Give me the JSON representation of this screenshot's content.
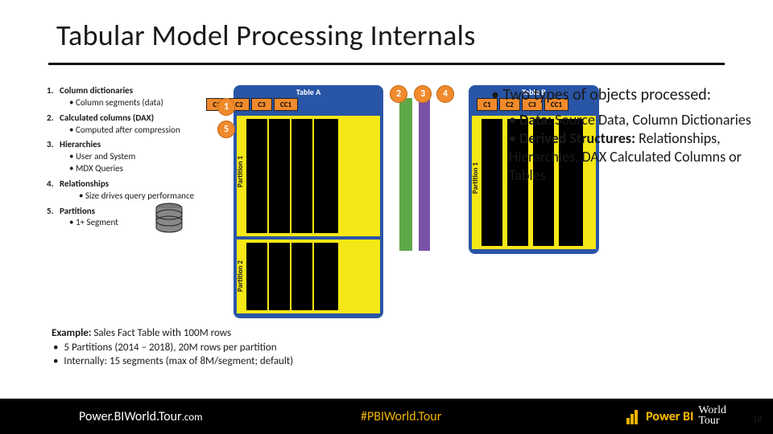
{
  "title": "Tabular Model Processing Internals",
  "leftList": [
    {
      "num": "1.",
      "label": "Column dictionaries",
      "sub": [
        "Column segments (data)"
      ]
    },
    {
      "num": "2.",
      "label": "Calculated columns (DAX)",
      "sub": [
        "Computed after compression"
      ]
    },
    {
      "num": "3.",
      "label": "Hierarchies",
      "sub": [
        "User and System",
        "MDX Queries"
      ]
    },
    {
      "num": "4.",
      "label": "Relationships",
      "sub": [
        "Size drives query performance"
      ]
    },
    {
      "num": "5.",
      "label": "Partitions",
      "sub": [
        "1+ Segment"
      ]
    }
  ],
  "diagram": {
    "tableA": {
      "title": "Table A",
      "cols": [
        "C1",
        "C2",
        "C3",
        "CC1"
      ],
      "part1": "Partition 1",
      "part2": "Partition 2"
    },
    "tableB": {
      "title": "Table B",
      "cols": [
        "C1",
        "C2",
        "C3",
        "CC1"
      ],
      "part1": "Partition 1"
    },
    "callouts": {
      "c1": "1",
      "c2": "2",
      "c3": "3",
      "c4": "4",
      "c5": "5"
    }
  },
  "right": {
    "line1": "Two types of objects processed:",
    "sub": [
      {
        "lead": "Data:",
        "rest": " Source Data, Column Dictionaries"
      },
      {
        "lead": "Derived Structures:",
        "rest": " Relationships, Hierarchies, DAX Calculated Columns or Tables"
      }
    ]
  },
  "example": {
    "head": "Example:",
    "headrest": " Sales Fact Table with 100M rows",
    "bullets": [
      "5 Partitions (2014 – 2018), 20M rows per partition",
      "Internally: 15 segments (max of 8M/segment; default)"
    ]
  },
  "footer": {
    "site_main": "Power.BIWorld.Tour",
    "site_suf": ".com",
    "hashtag": "#PBIWorld.Tour",
    "logo_power": "Power BI",
    "logo_world": "World",
    "logo_tour": "Tour",
    "page": "18"
  }
}
